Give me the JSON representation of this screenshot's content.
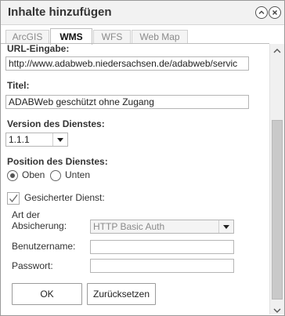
{
  "dialog": {
    "title": "Inhalte hinzufügen"
  },
  "tabs": [
    {
      "label": "ArcGIS",
      "active": false
    },
    {
      "label": "WMS",
      "active": true
    },
    {
      "label": "WFS",
      "active": false
    },
    {
      "label": "Web Map",
      "active": false
    }
  ],
  "form": {
    "url_label": "URL-Eingabe:",
    "url_value": "http://www.adabweb.niedersachsen.de/adabweb/servic",
    "title_label": "Titel:",
    "title_value": "ADABWeb geschützt ohne Zugang",
    "version_label": "Version des Dienstes:",
    "version_value": "1.1.1",
    "position_label": "Position des Dienstes:",
    "position_options": [
      "Oben",
      "Unten"
    ],
    "position_selected": "Oben",
    "secured_label": "Gesicherter Dienst:",
    "secured_checked": true,
    "auth_label_line1": "Art der",
    "auth_label_line2": "Absicherung:",
    "auth_value": "HTTP Basic Auth",
    "username_label": "Benutzername:",
    "username_value": "",
    "password_label": "Passwort:",
    "password_value": ""
  },
  "buttons": {
    "ok": "OK",
    "reset": "Zurücksetzen"
  },
  "icons": {
    "collapse": "chevron-up-icon",
    "close": "close-icon"
  }
}
